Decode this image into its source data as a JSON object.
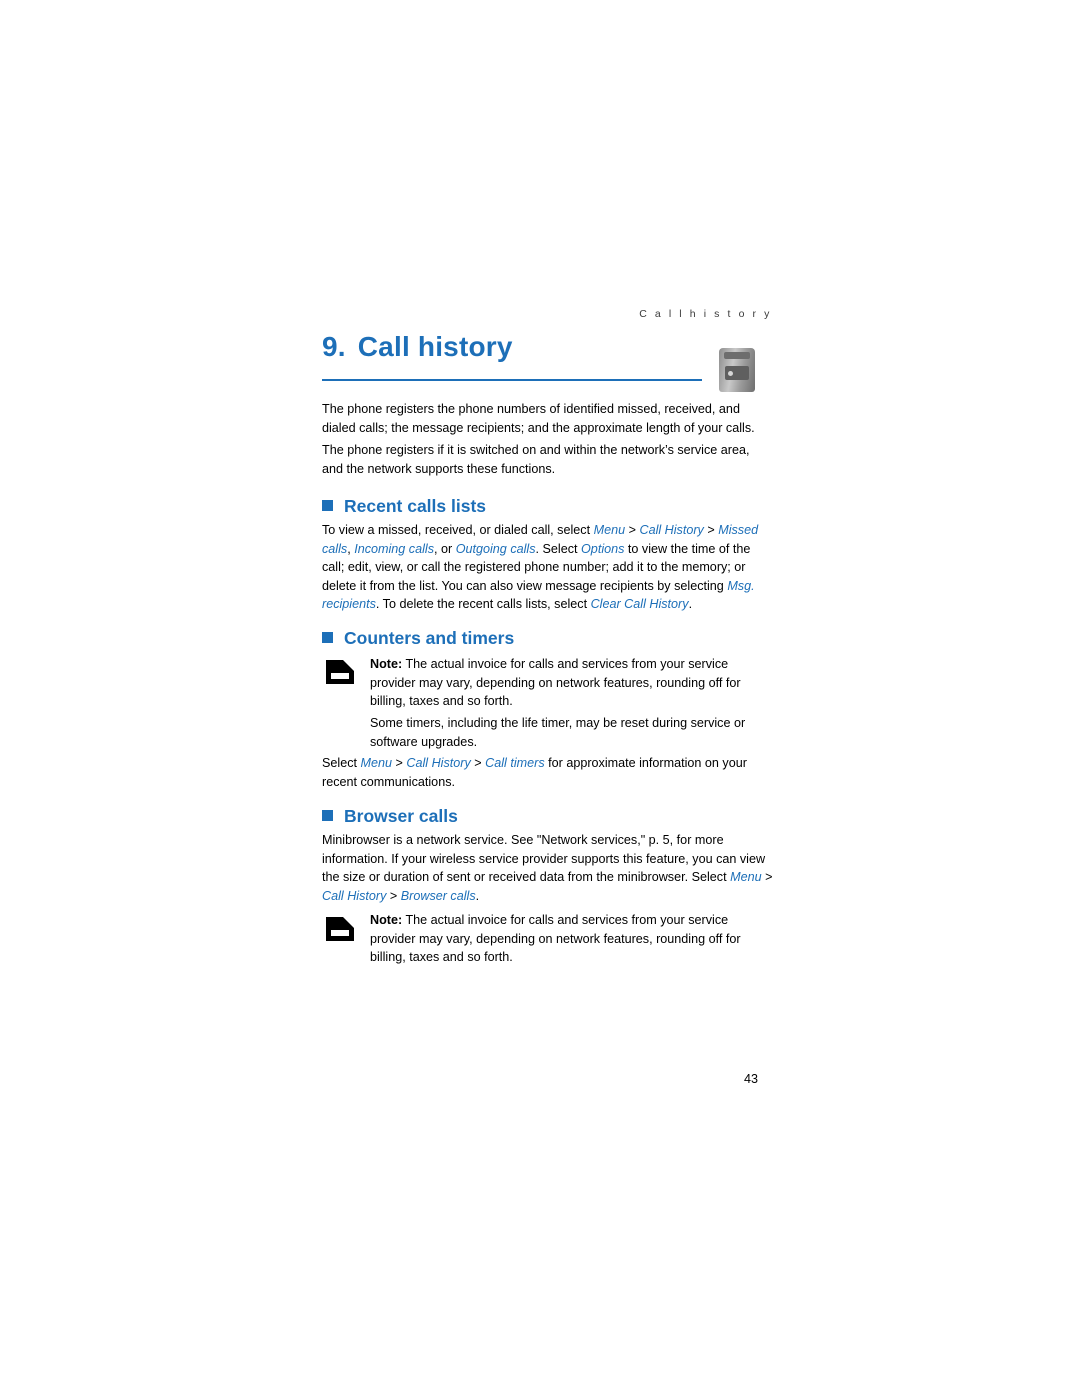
{
  "document": {
    "running_header": "C a l l   h i s t o r y",
    "chapter_number": "9.",
    "chapter_title": "Call history",
    "page_number": "43",
    "icons": {
      "phone": "phone-device-icon",
      "note": "note-callout-icon"
    },
    "accent_color": "#1d6fb8"
  },
  "intro": {
    "paragraph_1": "The phone registers the phone numbers of identified missed, received, and dialed calls; the message recipients; and the approximate length of your calls.",
    "paragraph_2": "The phone registers if it is switched on and within the network’s service area, and the network supports these functions."
  },
  "sections": {
    "recent_calls": {
      "heading": "Recent calls lists",
      "body": {
        "t1": "To view a missed, received, or dialed call, select ",
        "menu": "Menu",
        "gt1": " > ",
        "call_history": "Call History",
        "gt2": " > ",
        "missed_calls": "Missed calls",
        "t2": ", ",
        "incoming_calls": "Incoming calls",
        "t3": ", or ",
        "outgoing_calls": "Outgoing calls",
        "t4": ". Select ",
        "options": "Options",
        "t5": " to view the time of the call; edit, view, or call the registered phone number; add it to the memory; or delete it from the list. You can also view message recipients by selecting ",
        "msg_recipients": "Msg. recipients",
        "t6": ". To delete the recent calls lists, select ",
        "clear_call_history": "Clear Call History",
        "t7": "."
      }
    },
    "counters_timers": {
      "heading": "Counters and timers",
      "note": {
        "label": "Note:",
        "text": " The actual invoice for calls and services from your service provider may vary, depending on network features, rounding off for billing, taxes and so forth."
      },
      "note_para_2": "Some timers, including the life timer, may be reset during service or software upgrades.",
      "body": {
        "t1": "Select ",
        "menu": "Menu",
        "gt1": " > ",
        "call_history": "Call History",
        "gt2": " > ",
        "call_timers": "Call timers",
        "t2": " for approximate information on your recent communications."
      }
    },
    "browser_calls": {
      "heading": "Browser calls",
      "body": {
        "t1": "Minibrowser is a network service. See \"Network services,\" p. 5, for more information. If your wireless service provider supports this feature, you can view the size or duration of sent or received data from the minibrowser. Select ",
        "menu": "Menu",
        "gt1": " > ",
        "call_history": "Call History",
        "gt2": " > ",
        "browser_calls": "Browser calls",
        "t2": "."
      },
      "note": {
        "label": "Note:",
        "text": " The actual invoice for calls and services from your service provider may vary, depending on network features, rounding off for billing, taxes and so forth."
      }
    }
  }
}
